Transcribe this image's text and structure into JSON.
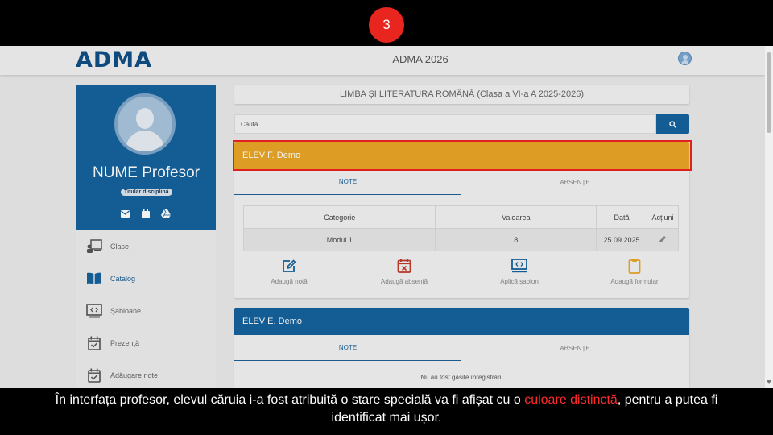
{
  "step_number": "3",
  "header": {
    "logo": "ADMA",
    "title": "ADMA 2026",
    "user_icon": "user-avatar-icon"
  },
  "profile": {
    "name": "NUME Profesor",
    "role": "Titular disciplină",
    "icons": [
      "mail-icon",
      "calendar-icon",
      "drive-icon"
    ]
  },
  "menu": {
    "items": [
      {
        "label": "Clase",
        "icon": "class-teacher-icon"
      },
      {
        "label": "Catalog",
        "icon": "book-open-icon"
      },
      {
        "label": "Șabloane",
        "icon": "template-code-icon"
      },
      {
        "label": "Prezență",
        "icon": "calendar-check-icon"
      },
      {
        "label": "Adăugare note",
        "icon": "calendar-check-icon"
      }
    ],
    "active": "Catalog"
  },
  "main": {
    "subject": "LIMBA ȘI LITERATURA ROMÂNĂ (Clasa a VI-a A 2025-2026)",
    "search": {
      "placeholder": "Caută.."
    },
    "students": [
      {
        "name": "ELEV F. Demo",
        "header_color": "#e9a526",
        "special_status": true,
        "tabs": [
          "NOTE",
          "ABSENȚE"
        ],
        "table": {
          "headers": [
            "Categorie",
            "Valoarea",
            "Dată",
            "Acțiuni"
          ],
          "rows": [
            {
              "categorie": "Modul 1",
              "valoarea": "8",
              "data": "25.09.2025",
              "actiune": "edit-pencil-icon"
            }
          ]
        },
        "actions": [
          {
            "label": "Adaugă notă",
            "icon": "edit-note-icon",
            "color": "#15619c"
          },
          {
            "label": "Adaugă absență",
            "icon": "calendar-x-icon",
            "color": "#c0392b"
          },
          {
            "label": "Aplică șablon",
            "icon": "template-code-icon",
            "color": "#15619c"
          },
          {
            "label": "Adaugă formular",
            "icon": "clipboard-icon",
            "color": "#e9a526"
          }
        ]
      },
      {
        "name": "ELEV E. Demo",
        "header_color": "#15619c",
        "special_status": false,
        "tabs": [
          "NOTE",
          "ABSENȚE"
        ],
        "empty_message": "Nu au fost găsite înregistrări."
      }
    ]
  },
  "caption": {
    "part1": "În interfața profesor, elevul căruia i-a fost atribuită o stare specială va fi afișat cu o ",
    "highlight": "culoare distinctă",
    "part2": ", pentru a putea fi",
    "line2": "identificat mai ușor."
  },
  "colors": {
    "primary": "#15619c",
    "special": "#e9a526",
    "highlight_frame": "#e02020",
    "caption_highlight": "#ff2b2b"
  }
}
